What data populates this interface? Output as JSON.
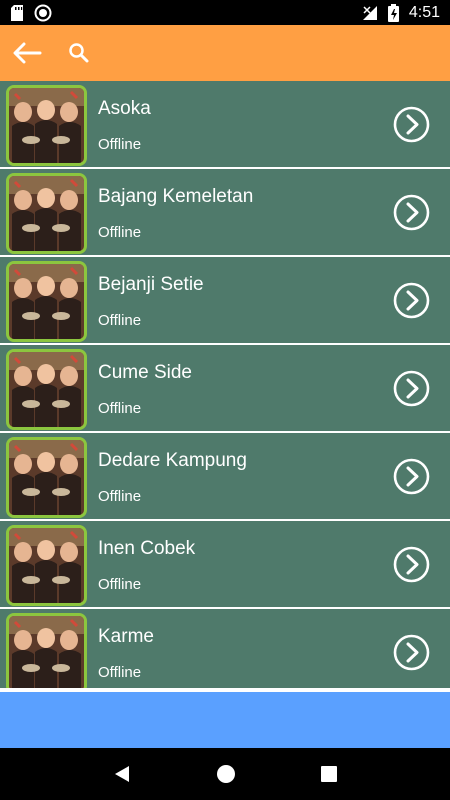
{
  "status_bar": {
    "time": "4:51"
  },
  "app_bar": {
    "back_icon": "arrow-left-icon",
    "search_icon": "search-icon"
  },
  "colors": {
    "app_bar": "#ff9f43",
    "row_bg": "#4f7a6b",
    "ad_bar": "#5aa0ff",
    "thumb_border": "#8cc63f"
  },
  "songs": [
    {
      "title": "Asoka",
      "status": "Offline"
    },
    {
      "title": "Bajang Kemeletan",
      "status": "Offline"
    },
    {
      "title": "Bejanji Setie",
      "status": "Offline"
    },
    {
      "title": "Cume Side",
      "status": "Offline"
    },
    {
      "title": "Dedare Kampung",
      "status": "Offline"
    },
    {
      "title": "Inen Cobek",
      "status": "Offline"
    },
    {
      "title": "Karme",
      "status": "Offline"
    }
  ]
}
